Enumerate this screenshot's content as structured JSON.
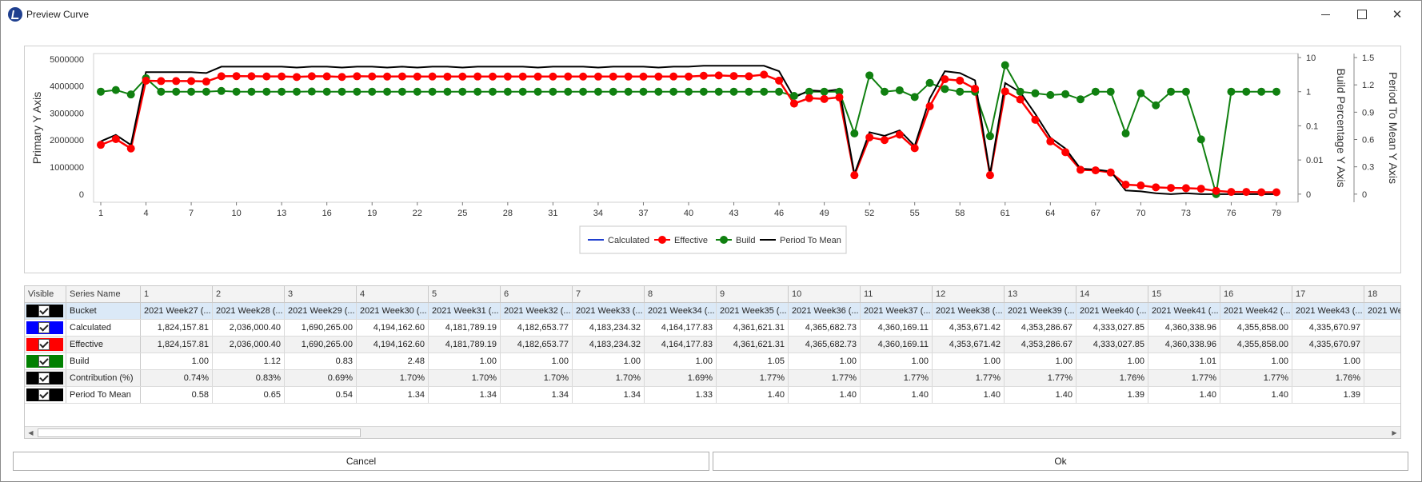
{
  "window": {
    "title": "Preview Curve"
  },
  "chart": {
    "legend": [
      "Calculated",
      "Effective",
      "Build",
      "Period To Mean"
    ],
    "primary_axis_label": "Primary Y Axis",
    "build_axis_label": "Build Percentage Y Axis",
    "period_axis_label": "Period To Mean Y Axis",
    "colors": {
      "calculated": "#1f3fcf",
      "effective": "#ff0000",
      "build": "#108010",
      "period": "#000000"
    }
  },
  "chart_data": {
    "type": "line",
    "x_ticks": [
      "1",
      "4",
      "7",
      "10",
      "13",
      "16",
      "19",
      "22",
      "25",
      "28",
      "31",
      "34",
      "37",
      "40",
      "43",
      "46",
      "49",
      "52",
      "55",
      "58",
      "61",
      "64",
      "67",
      "70",
      "73",
      "76",
      "79"
    ],
    "primary_ticks": [
      "5000000",
      "4000000",
      "3000000",
      "2000000",
      "1000000",
      "0"
    ],
    "primary_ylim": [
      -300000,
      5200000
    ],
    "build_ticks": [
      "10",
      "1",
      "0.1",
      "0.01",
      "0"
    ],
    "build_scale": "log",
    "period_ticks": [
      "1.5",
      "1.2",
      "0.9",
      "0.6",
      "0.3",
      "0"
    ],
    "period_ylim": [
      0,
      1.5
    ],
    "series": [
      {
        "name": "Effective",
        "axis": "primary",
        "values": [
          1824158,
          2036000,
          1690265,
          4194163,
          4181789,
          4182654,
          4183234,
          4164178,
          4361621,
          4365683,
          4360169,
          4353671,
          4353287,
          4333028,
          4360339,
          4355858,
          4335671,
          4360000,
          4355000,
          4350000,
          4355000,
          4350000,
          4352000,
          4348000,
          4350000,
          4352000,
          4350000,
          4350000,
          4351000,
          4349000,
          4350000,
          4352000,
          4350000,
          4349000,
          4351000,
          4350000,
          4350000,
          4349000,
          4352000,
          4350000,
          4380000,
          4390000,
          4370000,
          4360000,
          4420000,
          4200000,
          3350000,
          3550000,
          3520000,
          3580000,
          700000,
          2100000,
          2000000,
          2200000,
          1700000,
          3250000,
          4250000,
          4200000,
          3900000,
          700000,
          3800000,
          3500000,
          2750000,
          1950000,
          1550000,
          900000,
          880000,
          800000,
          350000,
          320000,
          250000,
          230000,
          220000,
          200000,
          120000,
          80000,
          80000,
          70000,
          70000
        ]
      },
      {
        "name": "Calculated",
        "axis": "primary",
        "values": [
          1824158,
          2036000,
          1690265,
          4194163,
          4181789,
          4182654,
          4183234,
          4164178,
          4361621,
          4365683,
          4360169,
          4353671,
          4353287,
          4333028,
          4360339,
          4355858,
          4335671,
          4360000,
          4355000,
          4350000,
          4355000,
          4350000,
          4352000,
          4348000,
          4350000,
          4352000,
          4350000,
          4350000,
          4351000,
          4349000,
          4350000,
          4352000,
          4350000,
          4349000,
          4351000,
          4350000,
          4350000,
          4349000,
          4352000,
          4350000,
          4380000,
          4390000,
          4370000,
          4360000,
          4420000,
          4200000,
          3350000,
          3550000,
          3520000,
          3580000,
          700000,
          2100000,
          2000000,
          2200000,
          1700000,
          3250000,
          4250000,
          4200000,
          3900000,
          700000,
          3800000,
          3500000,
          2750000,
          1950000,
          1550000,
          900000,
          880000,
          800000,
          350000,
          320000,
          250000,
          230000,
          220000,
          200000,
          120000,
          80000,
          80000,
          70000,
          70000
        ]
      },
      {
        "name": "Build",
        "axis": "build",
        "values": [
          1.0,
          1.12,
          0.83,
          2.48,
          1.0,
          1.0,
          1.0,
          1.0,
          1.05,
          1.0,
          1.0,
          1.0,
          1.0,
          1.0,
          1.01,
          1.0,
          1.0,
          1.0,
          1.0,
          1.0,
          1.0,
          1.0,
          1.0,
          1.0,
          1.0,
          1.0,
          1.0,
          1.0,
          1.0,
          1.0,
          1.0,
          1.0,
          1.0,
          1.0,
          1.0,
          1.0,
          1.0,
          1.0,
          1.0,
          1.0,
          1.0,
          1.0,
          1.0,
          1.0,
          1.0,
          1.0,
          0.75,
          1.0,
          1.0,
          1.0,
          0.06,
          3.0,
          1.0,
          1.1,
          0.7,
          1.8,
          1.2,
          1.0,
          1.0,
          0.05,
          6.0,
          1.0,
          0.9,
          0.8,
          0.85,
          0.6,
          1.0,
          1.0,
          0.06,
          0.9,
          0.4,
          1.0,
          1.0,
          0.04,
          0.0,
          1.0,
          1.0,
          1.0,
          1.0
        ]
      },
      {
        "name": "Period To Mean",
        "axis": "period",
        "values": [
          0.58,
          0.65,
          0.54,
          1.34,
          1.34,
          1.34,
          1.34,
          1.33,
          1.4,
          1.4,
          1.4,
          1.4,
          1.4,
          1.39,
          1.4,
          1.4,
          1.39,
          1.4,
          1.4,
          1.39,
          1.4,
          1.39,
          1.4,
          1.4,
          1.39,
          1.4,
          1.4,
          1.4,
          1.4,
          1.39,
          1.4,
          1.4,
          1.4,
          1.39,
          1.4,
          1.4,
          1.4,
          1.39,
          1.4,
          1.4,
          1.41,
          1.41,
          1.41,
          1.41,
          1.41,
          1.35,
          1.06,
          1.14,
          1.13,
          1.15,
          0.22,
          0.68,
          0.64,
          0.7,
          0.53,
          1.05,
          1.35,
          1.33,
          1.25,
          0.22,
          1.22,
          1.12,
          0.88,
          0.62,
          0.5,
          0.28,
          0.27,
          0.25,
          0.04,
          0.03,
          0.01,
          0.0,
          0.01,
          0.0,
          0.0,
          0.0,
          0.0,
          0.0,
          0.0
        ]
      }
    ]
  },
  "grid": {
    "headers": [
      "Visible",
      "Series Name",
      "1",
      "2",
      "3",
      "4",
      "5",
      "6",
      "7",
      "8",
      "9",
      "10",
      "11",
      "12",
      "13",
      "14",
      "15",
      "16",
      "17",
      "18"
    ],
    "rows": [
      {
        "name": "Bucket",
        "swatch": "#000000",
        "cells": [
          "2021 Week27 (...",
          "2021 Week28 (...",
          "2021 Week29 (...",
          "2021 Week30 (...",
          "2021 Week31 (...",
          "2021 Week32 (...",
          "2021 Week33 (...",
          "2021 Week34 (...",
          "2021 Week35 (...",
          "2021 Week36 (...",
          "2021 Week37 (...",
          "2021 Week38 (...",
          "2021 Week39 (...",
          "2021 Week40 (...",
          "2021 Week41 (...",
          "2021 Week42 (...",
          "2021 Week43 (...",
          "2021 Wee"
        ]
      },
      {
        "name": "Calculated",
        "swatch": "#0000ff",
        "cells": [
          "1,824,157.81",
          "2,036,000.40",
          "1,690,265.00",
          "4,194,162.60",
          "4,181,789.19",
          "4,182,653.77",
          "4,183,234.32",
          "4,164,177.83",
          "4,361,621.31",
          "4,365,682.73",
          "4,360,169.11",
          "4,353,671.42",
          "4,353,286.67",
          "4,333,027.85",
          "4,360,338.96",
          "4,355,858.00",
          "4,335,670.97",
          "4,358"
        ]
      },
      {
        "name": "Effective",
        "swatch": "#ff0000",
        "cells": [
          "1,824,157.81",
          "2,036,000.40",
          "1,690,265.00",
          "4,194,162.60",
          "4,181,789.19",
          "4,182,653.77",
          "4,183,234.32",
          "4,164,177.83",
          "4,361,621.31",
          "4,365,682.73",
          "4,360,169.11",
          "4,353,671.42",
          "4,353,286.67",
          "4,333,027.85",
          "4,360,338.96",
          "4,355,858.00",
          "4,335,670.97",
          "4,358"
        ]
      },
      {
        "name": "Build",
        "swatch": "#008000",
        "cells": [
          "1.00",
          "1.12",
          "0.83",
          "2.48",
          "1.00",
          "1.00",
          "1.00",
          "1.00",
          "1.05",
          "1.00",
          "1.00",
          "1.00",
          "1.00",
          "1.00",
          "1.01",
          "1.00",
          "1.00",
          ""
        ]
      },
      {
        "name": "Contribution (%)",
        "swatch": "#000000",
        "cells": [
          "0.74%",
          "0.83%",
          "0.69%",
          "1.70%",
          "1.70%",
          "1.70%",
          "1.70%",
          "1.69%",
          "1.77%",
          "1.77%",
          "1.77%",
          "1.77%",
          "1.77%",
          "1.76%",
          "1.77%",
          "1.77%",
          "1.76%",
          ""
        ]
      },
      {
        "name": "Period To Mean",
        "swatch": "#000000",
        "cells": [
          "0.58",
          "0.65",
          "0.54",
          "1.34",
          "1.34",
          "1.34",
          "1.34",
          "1.33",
          "1.40",
          "1.40",
          "1.40",
          "1.40",
          "1.40",
          "1.39",
          "1.40",
          "1.40",
          "1.39",
          ""
        ]
      }
    ]
  },
  "buttons": {
    "cancel": "Cancel",
    "ok": "Ok"
  }
}
